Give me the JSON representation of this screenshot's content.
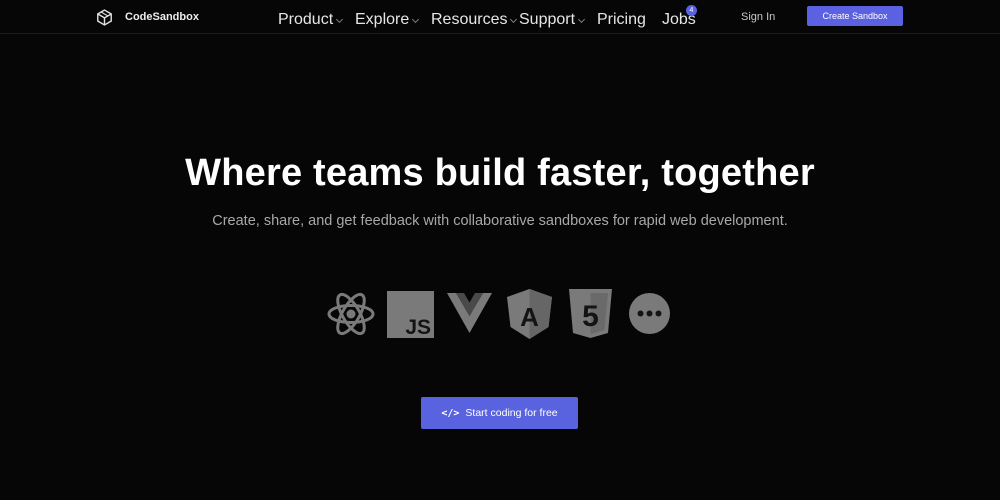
{
  "header": {
    "brand": "CodeSandbox",
    "nav": [
      {
        "label": "Product",
        "dropdown": true
      },
      {
        "label": "Explore",
        "dropdown": true
      },
      {
        "label": "Resources",
        "dropdown": true
      },
      {
        "label": "Support",
        "dropdown": true
      },
      {
        "label": "Pricing",
        "dropdown": false
      },
      {
        "label": "Jobs",
        "dropdown": false
      }
    ],
    "jobs_badge": "4",
    "sign_in": "Sign In",
    "create_button": "Create Sandbox"
  },
  "hero": {
    "title": "Where teams build faster, together",
    "subtitle": "Create, share, and get feedback with collaborative sandboxes for rapid web development.",
    "cta_icon": "</>",
    "cta_label": "Start coding for free"
  },
  "frameworks": [
    {
      "name": "react",
      "icon": "react-icon",
      "text": ""
    },
    {
      "name": "javascript",
      "icon": "javascript-icon",
      "text": "JS"
    },
    {
      "name": "vue",
      "icon": "vue-icon",
      "text": ""
    },
    {
      "name": "angular",
      "icon": "angular-icon",
      "text": "A"
    },
    {
      "name": "html5",
      "icon": "html5-icon",
      "text": "5"
    },
    {
      "name": "more",
      "icon": "more-icon",
      "text": ""
    }
  ],
  "colors": {
    "background": "#060606",
    "accent": "#5962df",
    "icon_gray": "#7a7a7a"
  }
}
